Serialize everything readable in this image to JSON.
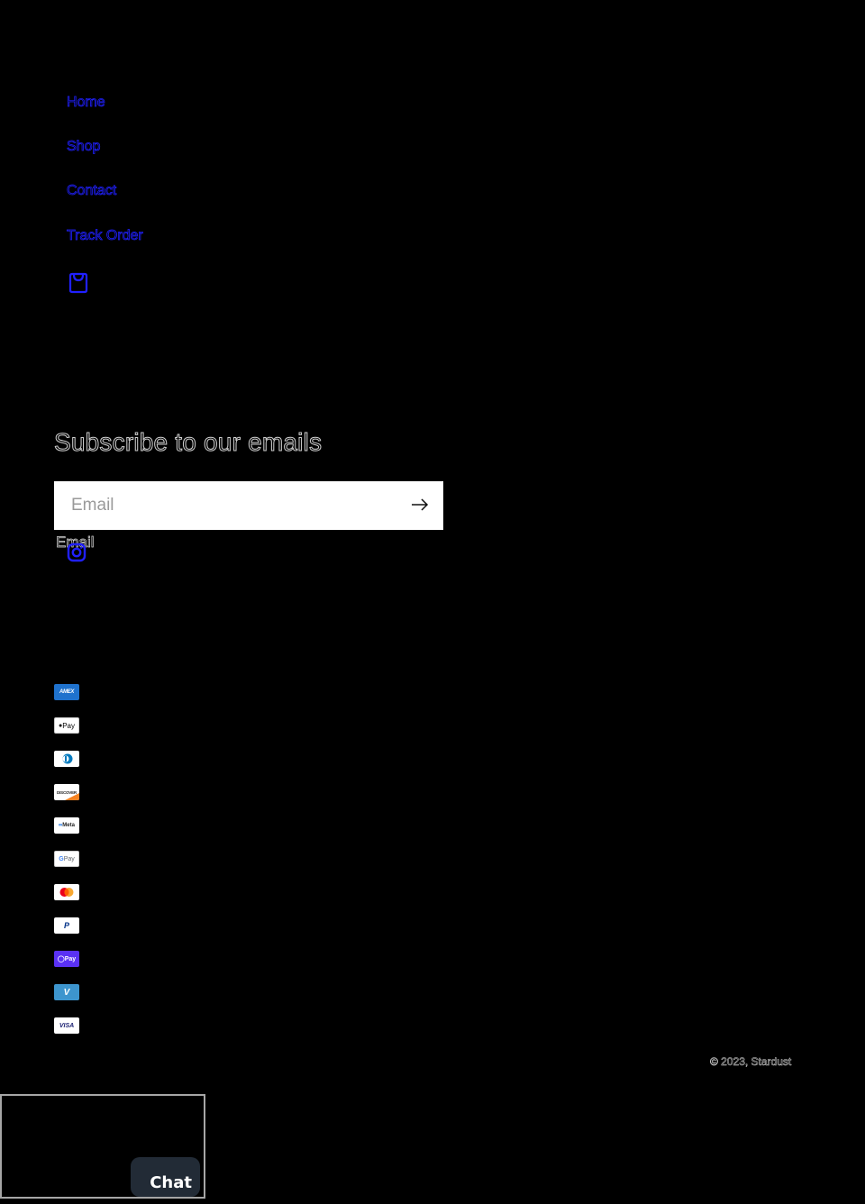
{
  "nav": {
    "links": [
      {
        "label": "Home"
      },
      {
        "label": "Shop"
      },
      {
        "label": "Contact"
      },
      {
        "label": "Track Order"
      }
    ],
    "cart_icon": "bag-icon",
    "link_color": "#2020ff"
  },
  "newsletter": {
    "heading": "Subscribe to our emails",
    "email_placeholder": "Email",
    "email_value": "",
    "email_label": "Email",
    "submit_icon": "arrow-right-icon"
  },
  "social": {
    "icons": [
      "instagram-icon"
    ]
  },
  "payments": {
    "methods": [
      {
        "name": "American Express",
        "icon": "amex-icon",
        "text": "AMEX"
      },
      {
        "name": "Apple Pay",
        "icon": "apple-pay-icon",
        "text": "Pay"
      },
      {
        "name": "Diners Club",
        "icon": "diners-club-icon",
        "text": ""
      },
      {
        "name": "Discover",
        "icon": "discover-icon",
        "text": "DISCOVER"
      },
      {
        "name": "Meta Pay",
        "icon": "meta-pay-icon",
        "text": "Meta"
      },
      {
        "name": "Google Pay",
        "icon": "google-pay-icon",
        "text": "Pay"
      },
      {
        "name": "Mastercard",
        "icon": "mastercard-icon",
        "text": ""
      },
      {
        "name": "PayPal",
        "icon": "paypal-icon",
        "text": "P"
      },
      {
        "name": "Shop Pay",
        "icon": "shop-pay-icon",
        "text": "Pay"
      },
      {
        "name": "Venmo",
        "icon": "venmo-icon",
        "text": "V"
      },
      {
        "name": "Visa",
        "icon": "visa-icon",
        "text": "VISA"
      }
    ]
  },
  "footer": {
    "copyright": "© 2023, Stardust"
  },
  "chat": {
    "button_label": "Chat"
  }
}
